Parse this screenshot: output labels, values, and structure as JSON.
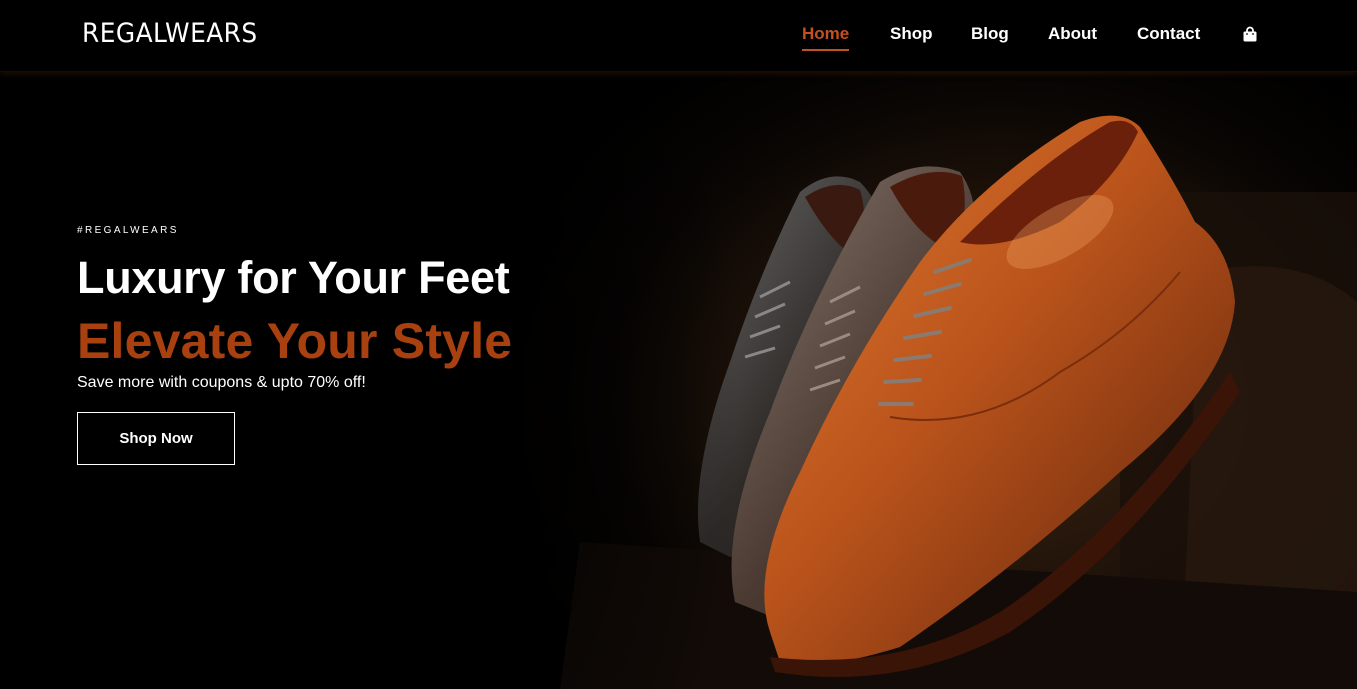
{
  "brand": {
    "logo_text": "REGALWEARS"
  },
  "nav": {
    "items": [
      {
        "label": "Home",
        "active": true
      },
      {
        "label": "Shop",
        "active": false
      },
      {
        "label": "Blog",
        "active": false
      },
      {
        "label": "About",
        "active": false
      },
      {
        "label": "Contact",
        "active": false
      }
    ],
    "cart_icon": "shopping-bag-icon"
  },
  "hero": {
    "eyebrow": "#REGALWEARS",
    "headline": "Luxury for Your Feet",
    "headline_accent": "Elevate Your Style",
    "subtext": "Save more with coupons & upto 70% off!",
    "cta_label": "Shop Now",
    "image_subject": "three leather oxford shoes"
  },
  "colors": {
    "accent": "#c4501f",
    "headline_accent": "#a8410f",
    "background": "#000000"
  }
}
